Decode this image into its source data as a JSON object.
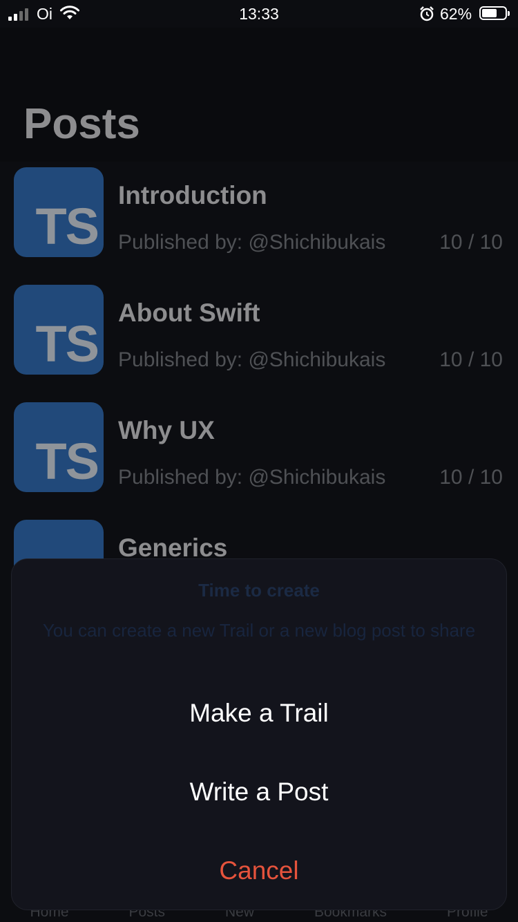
{
  "status_bar": {
    "carrier": "Oi",
    "time": "13:33",
    "battery": "62%",
    "battery_level": 0.62,
    "icons": [
      "signal-icon",
      "wifi-icon",
      "alarm-icon",
      "battery-icon"
    ]
  },
  "page_title": "Posts",
  "posts": [
    {
      "thumb": "TS",
      "title": "Introduction",
      "author": "Published by: @Shichibukais",
      "score": "10 / 10"
    },
    {
      "thumb": "TS",
      "title": "About Swift",
      "author": "Published by: @Shichibukais",
      "score": "10 / 10"
    },
    {
      "thumb": "TS",
      "title": "Why UX",
      "author": "Published by: @Shichibukais",
      "score": "10 / 10"
    },
    {
      "thumb": "",
      "title": "Generics",
      "author": "",
      "score": ""
    }
  ],
  "action_sheet": {
    "title": "Time to create",
    "message": "You can create a new Trail or a new blog post to share",
    "make_trail": "Make a Trail",
    "write_post": "Write a Post",
    "cancel": "Cancel",
    "cancel_color": "#e5533c"
  },
  "tabs": [
    "Home",
    "Posts",
    "New",
    "Bookmarks",
    "Profile"
  ]
}
